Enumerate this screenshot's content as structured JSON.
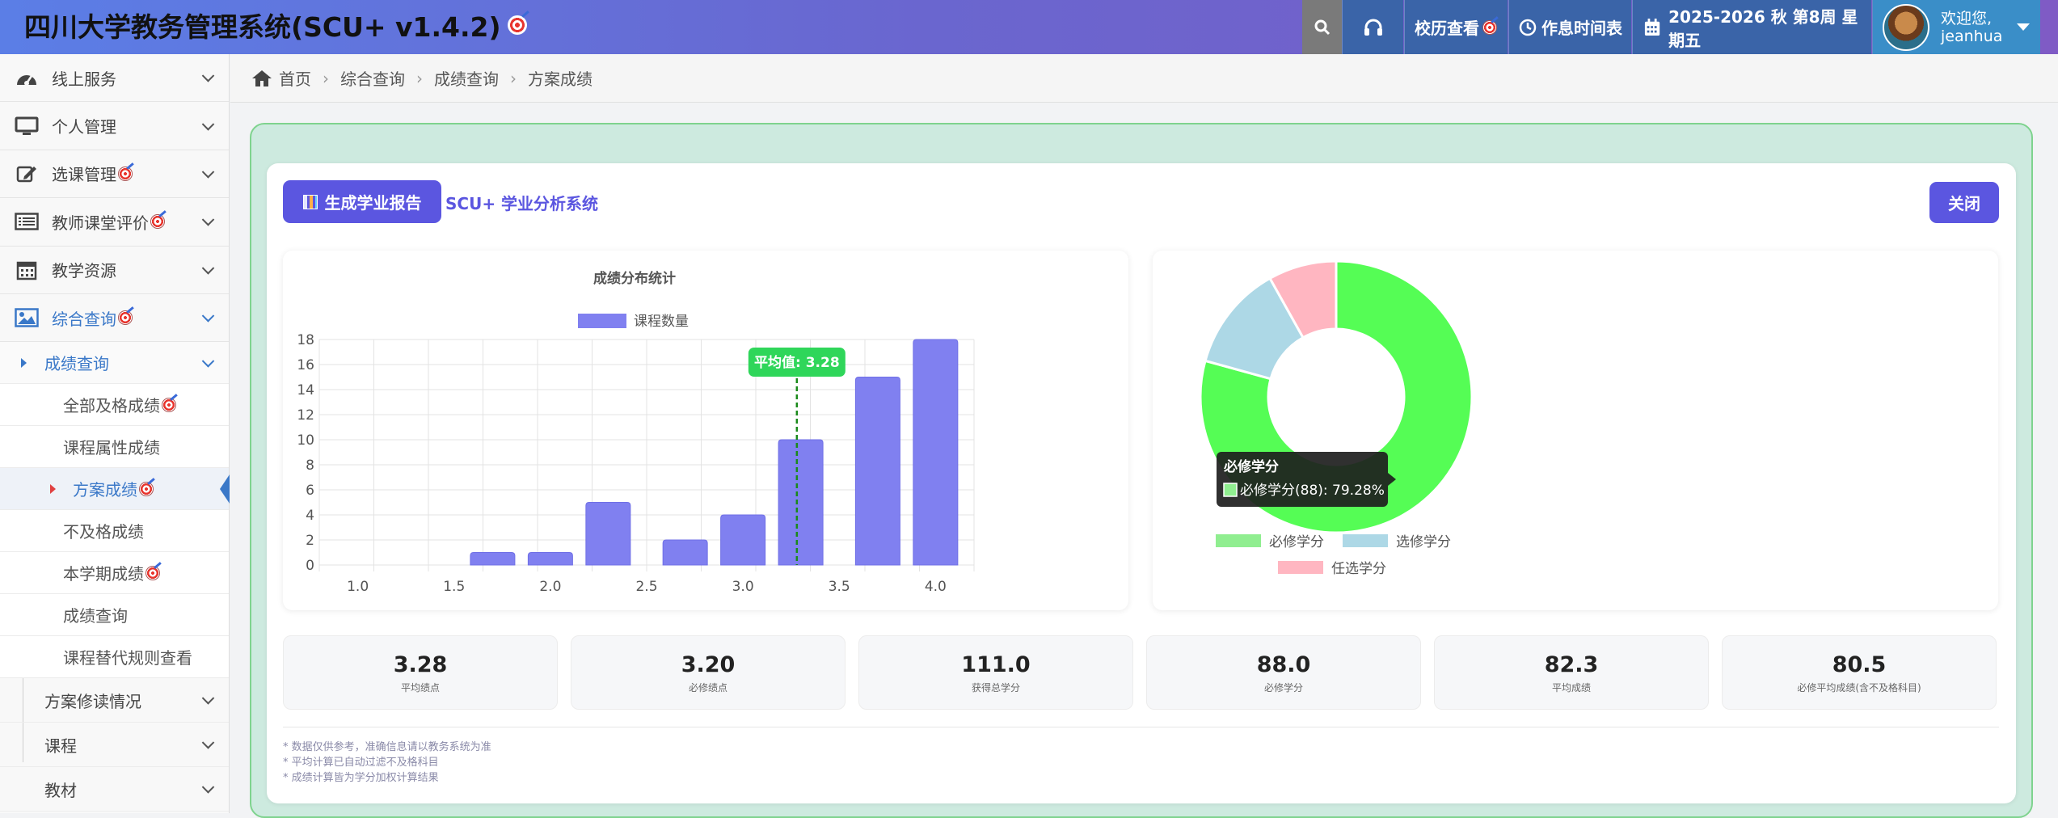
{
  "app": {
    "title": "四川大学教务管理系统(SCU+ v1.4.2)"
  },
  "topbar": {
    "calendar_view": "校历查看",
    "schedule": "作息时间表",
    "term": "2025-2026 秋 第8周 星期五",
    "welcome": "欢迎您,",
    "username": "jeanhua"
  },
  "sidebar": {
    "items": [
      {
        "label": "线上服务",
        "icon": "dashboard-icon"
      },
      {
        "label": "个人管理",
        "icon": "monitor-icon"
      },
      {
        "label": "选课管理",
        "icon": "edit-icon"
      },
      {
        "label": "教师课堂评价",
        "icon": "list-icon"
      },
      {
        "label": "教学资源",
        "icon": "calendar-icon"
      },
      {
        "label": "综合查询",
        "icon": "image-icon"
      }
    ],
    "sub_group": "成绩查询",
    "sub_items": [
      "全部及格成绩",
      "课程属性成绩",
      "方案成绩",
      "不及格成绩",
      "本学期成绩",
      "成绩查询",
      "课程替代规则查看"
    ],
    "bottom_items": [
      "方案修读情况",
      "课程",
      "教材"
    ]
  },
  "breadcrumb": [
    "首页",
    "综合查询",
    "成绩查询",
    "方案成绩"
  ],
  "main": {
    "report_button": "生成学业报告",
    "system_title": "SCU+ 学业分析系统",
    "close_button": "关闭",
    "avg_badge": "平均值: 3.28",
    "tooltip_title": "必修学分",
    "tooltip_body": "必修学分(88): 79.28%",
    "stats": [
      {
        "value": "3.28",
        "label": "平均绩点"
      },
      {
        "value": "3.20",
        "label": "必修绩点"
      },
      {
        "value": "111.0",
        "label": "获得总学分"
      },
      {
        "value": "88.0",
        "label": "必修学分"
      },
      {
        "value": "82.3",
        "label": "平均成绩"
      },
      {
        "value": "80.5",
        "label": "必修平均成绩(含不及格科目)"
      }
    ],
    "notes": [
      "* 数据仅供参考，准确信息请以教务系统为准",
      "* 平均计算已自动过滤不及格科目",
      "* 成绩计算皆为学分加权计算结果"
    ]
  },
  "chart_data": [
    {
      "type": "bar",
      "title": "成绩分布统计",
      "legend": [
        "课程数量"
      ],
      "x": [
        1.0,
        1.3,
        1.7,
        2.0,
        2.3,
        2.7,
        3.0,
        3.3,
        3.7,
        4.0
      ],
      "series": [
        {
          "name": "课程数量",
          "values": [
            0,
            0,
            1,
            1,
            5,
            2,
            4,
            10,
            15,
            18
          ],
          "color": "#8080f0"
        }
      ],
      "xticks": [
        "1.0",
        "1.5",
        "2.0",
        "2.5",
        "3.0",
        "3.5",
        "4.0"
      ],
      "yticks": [
        "0",
        "2",
        "4",
        "6",
        "8",
        "10",
        "12",
        "14",
        "16",
        "18"
      ],
      "xlim": [
        0.8,
        4.2
      ],
      "ylim": [
        0,
        18
      ],
      "mean_line": 3.28
    },
    {
      "type": "pie",
      "labels": [
        "必修学分",
        "选修学分",
        "任选学分"
      ],
      "values": [
        88,
        14,
        9
      ],
      "colors": [
        "#55fd55",
        "#add8e6",
        "#ffb6c1"
      ],
      "legend_colors": [
        "#90ee90",
        "#add8e6",
        "#ffb6c1"
      ]
    }
  ]
}
